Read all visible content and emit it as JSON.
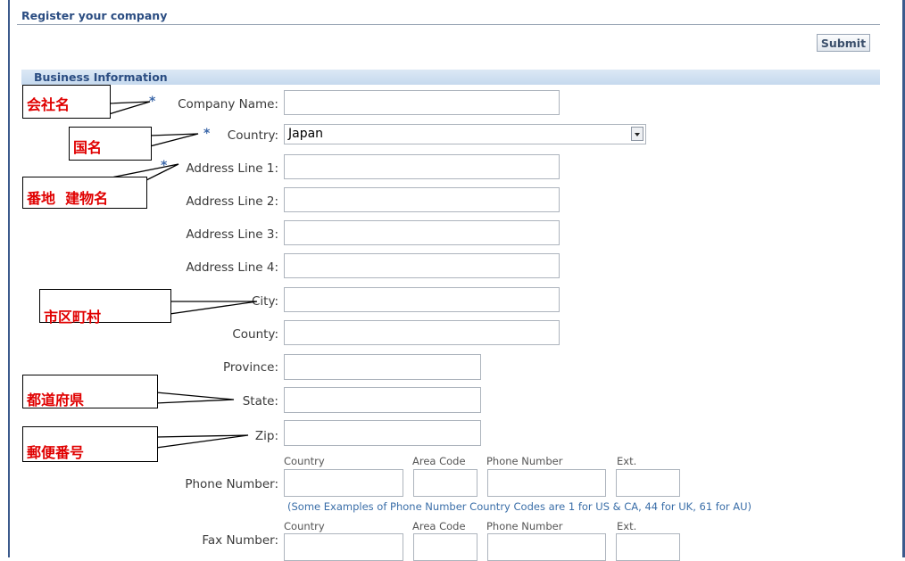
{
  "page": {
    "title": "Register your company",
    "submit_label": "Submit"
  },
  "section": {
    "title": "Business Information"
  },
  "form": {
    "company_name_label": "Company Name:",
    "country_label": "Country:",
    "country_value": "Japan",
    "address1_label": "Address Line 1:",
    "address2_label": "Address Line 2:",
    "address3_label": "Address Line 3:",
    "address4_label": "Address Line 4:",
    "city_label": "City:",
    "county_label": "County:",
    "province_label": "Province:",
    "state_label": "State:",
    "zip_label": "Zip:",
    "phone_label": "Phone Number:",
    "fax_label": "Fax Number:",
    "required_mark": "*",
    "phone_columns": [
      "Country",
      "Area Code",
      "Phone Number",
      "Ext."
    ],
    "phone_hint": "(Some Examples of Phone Number Country Codes are 1 for US & CA, 44 for UK, 61 for AU)"
  },
  "annotations": {
    "company_name": "会社名",
    "country": "国名",
    "address": "番地  建物名",
    "city": "市区町村",
    "state": "都道府県",
    "zip": "郵便番号"
  },
  "colors": {
    "frame": "#3c5a8c",
    "title": "#2b4d82",
    "annotation_text": "#e00000",
    "hint": "#3a6ea8",
    "required": "#3a66a8"
  }
}
